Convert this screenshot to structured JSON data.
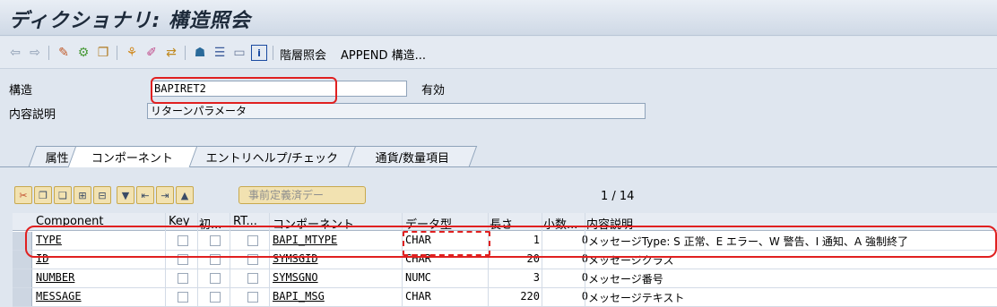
{
  "window": {
    "title": "ディクショナリ: 構造照会"
  },
  "toolbar": {
    "hierarchy_label": "階層照会",
    "append_label": "APPEND 構造..."
  },
  "header": {
    "structure_label": "構造",
    "structure_value": "BAPIRET2",
    "status_text": "有効",
    "description_label": "内容説明",
    "description_value": "リターンパラメータ"
  },
  "tabs": [
    {
      "label": "属性"
    },
    {
      "label": "コンポーネント"
    },
    {
      "label": "エントリヘルプ/チェック"
    },
    {
      "label": "通貨/数量項目"
    }
  ],
  "grid_toolbar": {
    "predefined_type_label": "事前定義済デー",
    "pager": "1 / 14"
  },
  "table": {
    "columns": [
      "Component",
      "Key",
      "初...",
      "RT...",
      "コンポーネント",
      "データ型",
      "長さ",
      "小数...",
      "内容説明"
    ],
    "rows": [
      {
        "component": "TYPE",
        "comp_type": "BAPI_MTYPE",
        "data_type": "CHAR",
        "length": "1",
        "decimals": "0",
        "description": "メッセージType: S 正常、E エラー、W 警告、I 通知、A 強制終了"
      },
      {
        "component": "ID",
        "comp_type": "SYMSGID",
        "data_type": "CHAR",
        "length": "20",
        "decimals": "0",
        "description": "メッセージクラス"
      },
      {
        "component": "NUMBER",
        "comp_type": "SYMSGNO",
        "data_type": "NUMC",
        "length": "3",
        "decimals": "0",
        "description": "メッセージ番号"
      },
      {
        "component": "MESSAGE",
        "comp_type": "BAPI_MSG",
        "data_type": "CHAR",
        "length": "220",
        "decimals": "0",
        "description": "メッセージテキスト"
      }
    ]
  },
  "icons": [
    "back-icon",
    "forward-icon",
    "display-change-icon",
    "activate-icon",
    "check-icon",
    "hierarchy-icon",
    "where-used-icon",
    "object-list-icon",
    "technical-settings-icon",
    "info-icon"
  ],
  "colors": {
    "highlight": "#e02020",
    "title_text": "#1d2a3a"
  }
}
